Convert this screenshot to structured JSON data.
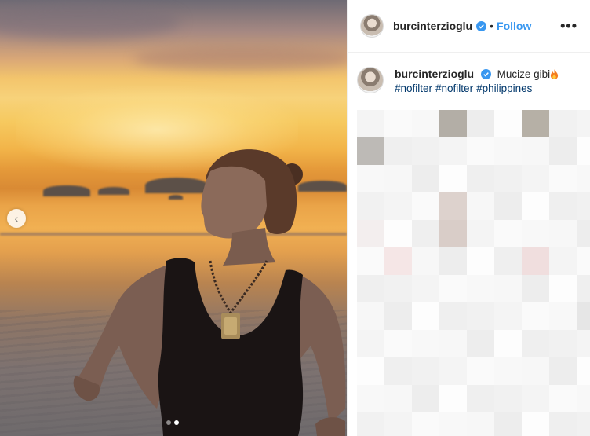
{
  "post": {
    "author": {
      "username": "burcinterzioglu",
      "verified": true
    },
    "header": {
      "separator": "•",
      "follow_label": "Follow",
      "more_label": "•••"
    },
    "caption": {
      "username": "burcinterzioglu",
      "text": "Mucize gibi",
      "emoji": "fire",
      "hashtags": [
        "#nofilter",
        "#nofilter",
        "#philippines"
      ]
    },
    "carousel": {
      "prev_label": "‹",
      "slide_count": 2,
      "active_slide": 2
    },
    "colors": {
      "follow": "#3897f0",
      "hashtag": "#00376b",
      "verified": "#3897f0",
      "text": "#262626"
    },
    "icons": [
      "verified-badge-icon",
      "more-options-icon",
      "chevron-left-icon",
      "fire-emoji-icon"
    ]
  }
}
